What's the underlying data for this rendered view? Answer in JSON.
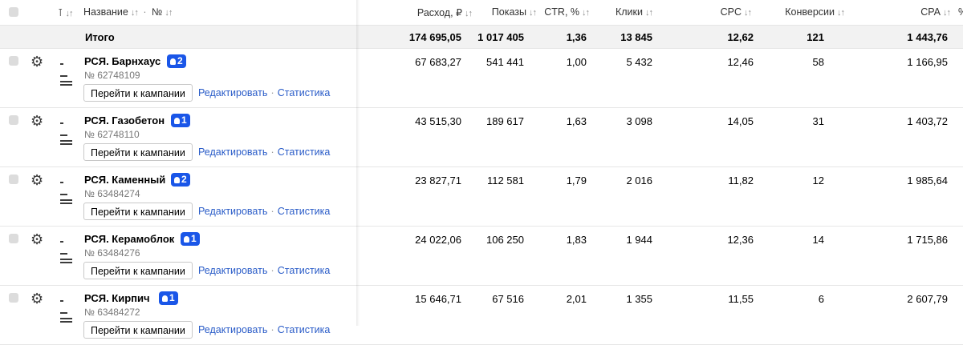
{
  "header": {
    "flag_col": "⊺",
    "name": "Название",
    "sep": "·",
    "number": "№",
    "cols": [
      "Расход, ₽",
      "Показы",
      "CTR, %",
      "Клики",
      "CPC",
      "Конверсии",
      "CPA"
    ],
    "last_fragment": "%"
  },
  "total": {
    "label": "Итого",
    "values": [
      "174 695,05",
      "1 017 405",
      "1,36",
      "13 845",
      "12,62",
      "121",
      "1 443,76"
    ]
  },
  "actions": {
    "go": "Перейти к кампании",
    "edit": "Редактировать",
    "stats": "Статистика",
    "dot": "·"
  },
  "rows": [
    {
      "name": "РСЯ. Барнхаус",
      "badge": "2",
      "id": "№ 62748109",
      "values": [
        "67 683,27",
        "541 441",
        "1,00",
        "5 432",
        "12,46",
        "58",
        "1 166,95"
      ]
    },
    {
      "name": "РСЯ. Газобетон",
      "badge": "1",
      "id": "№ 62748110",
      "values": [
        "43 515,30",
        "189 617",
        "1,63",
        "3 098",
        "14,05",
        "31",
        "1 403,72"
      ]
    },
    {
      "name": "РСЯ. Каменный",
      "badge": "2",
      "id": "№ 63484274",
      "values": [
        "23 827,71",
        "112 581",
        "1,79",
        "2 016",
        "11,82",
        "12",
        "1 985,64"
      ]
    },
    {
      "name": "РСЯ. Керамоблок",
      "badge": "1",
      "id": "№ 63484276",
      "values": [
        "24 022,06",
        "106 250",
        "1,83",
        "1 944",
        "12,36",
        "14",
        "1 715,86"
      ]
    },
    {
      "name": "РСЯ. Кирпич",
      "badge": "1",
      "id": "№ 63484272",
      "values": [
        "15 646,71",
        "67 516",
        "2,01",
        "1 355",
        "11,55",
        "6",
        "2 607,79"
      ]
    }
  ],
  "colors": {
    "accent": "#1a56e8",
    "link": "#2a5cc8",
    "total_bg": "#f2f2f2"
  },
  "icons": {
    "row_settings": "gear-icon",
    "row_type": "text-ad-icon",
    "badge": "lightbulb-icon",
    "sort": "sort-arrows-icon"
  }
}
